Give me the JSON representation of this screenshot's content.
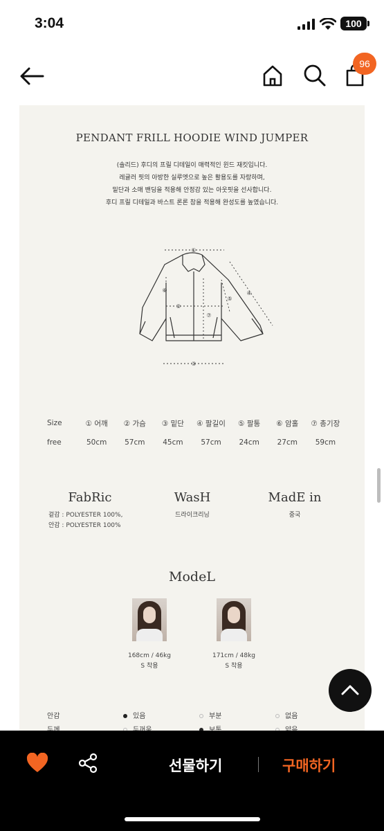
{
  "status_bar": {
    "time": "3:04",
    "battery": "100"
  },
  "header": {
    "cart_badge": "96"
  },
  "product": {
    "title": "PENDANT FRILL HOODIE WIND JUMPER",
    "description": [
      "(솔리드) 후디의 프릴 디테일이 매력적인 윈드 재킷입니다.",
      "레귤러 핏의 아방한 실루엣으로 높은 활용도를 자랑하며,",
      "밑단과 소매 밴딩을 적용해 안정감 있는 아웃핏을 선사합니다.",
      "후디 프릴 디테일과 바스트 론론 참을 적용해 완성도를 높였습니다."
    ],
    "diagram_markers": [
      "①",
      "②",
      "③",
      "④",
      "⑤",
      "⑥",
      "⑦"
    ]
  },
  "size_table": {
    "headers": [
      "Size",
      "① 어깨",
      "② 가슴",
      "③ 밑단",
      "④ 팔길이",
      "⑤ 팔통",
      "⑥ 암홀",
      "⑦ 총기장"
    ],
    "values": [
      "free",
      "50cm",
      "57cm",
      "45cm",
      "57cm",
      "24cm",
      "27cm",
      "59cm"
    ]
  },
  "info": {
    "fabric": {
      "title": "FabRic",
      "lines": [
        "겉감 : POLYESTER 100%,",
        "안감 : POLYESTER 100%"
      ]
    },
    "wash": {
      "title": "WasH",
      "lines": [
        "드라이크리닝"
      ]
    },
    "made_in": {
      "title": "MadE in",
      "lines": [
        "중국"
      ]
    }
  },
  "models": {
    "title": "ModeL",
    "items": [
      {
        "spec": "168cm / 46kg",
        "size": "S 착용"
      },
      {
        "spec": "171cm / 48kg",
        "size": "S 착용"
      }
    ]
  },
  "options": [
    {
      "label": "안감",
      "choices": [
        {
          "text": "있음",
          "selected": true
        },
        {
          "text": "부분",
          "selected": false
        },
        {
          "text": "없음",
          "selected": false
        }
      ]
    },
    {
      "label": "두께",
      "choices": [
        {
          "text": "두꺼움",
          "selected": false
        },
        {
          "text": "보통",
          "selected": true
        },
        {
          "text": "얇음",
          "selected": false
        }
      ]
    }
  ],
  "bottom_bar": {
    "gift_label": "선물하기",
    "buy_label": "구매하기"
  },
  "colors": {
    "accent": "#f26522",
    "card_bg": "#f4f3ee",
    "bar_bg": "#000000"
  },
  "icons": [
    "back-arrow-icon",
    "home-icon",
    "search-icon",
    "shopping-bag-icon",
    "heart-icon",
    "share-icon",
    "chevron-up-icon"
  ]
}
